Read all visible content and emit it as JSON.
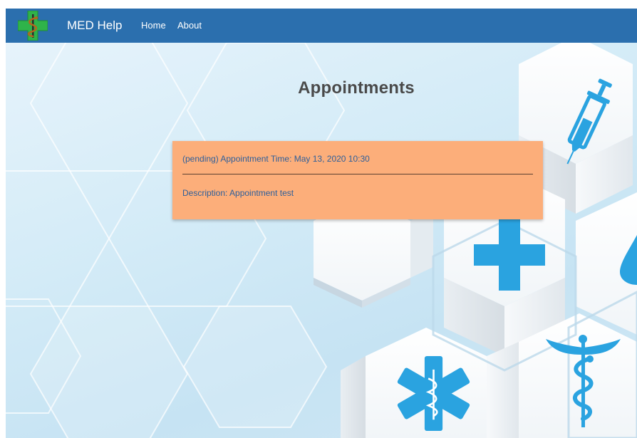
{
  "navbar": {
    "brand": "MED Help",
    "links": [
      {
        "label": "Home"
      },
      {
        "label": "About"
      }
    ],
    "bg_color": "#2b6fae"
  },
  "main": {
    "title": "Appointments",
    "appointments": [
      {
        "header": "(pending) Appointment Time: May 13, 2020 10:30",
        "description": "Description: Appointment test",
        "card_color": "#fcae7a"
      }
    ]
  },
  "icons": {
    "logo": "caduceus-cross-logo-icon",
    "background": [
      "syringe-icon",
      "medical-cross-icon",
      "drop-icon",
      "star-of-life-icon",
      "caduceus-icon"
    ]
  }
}
